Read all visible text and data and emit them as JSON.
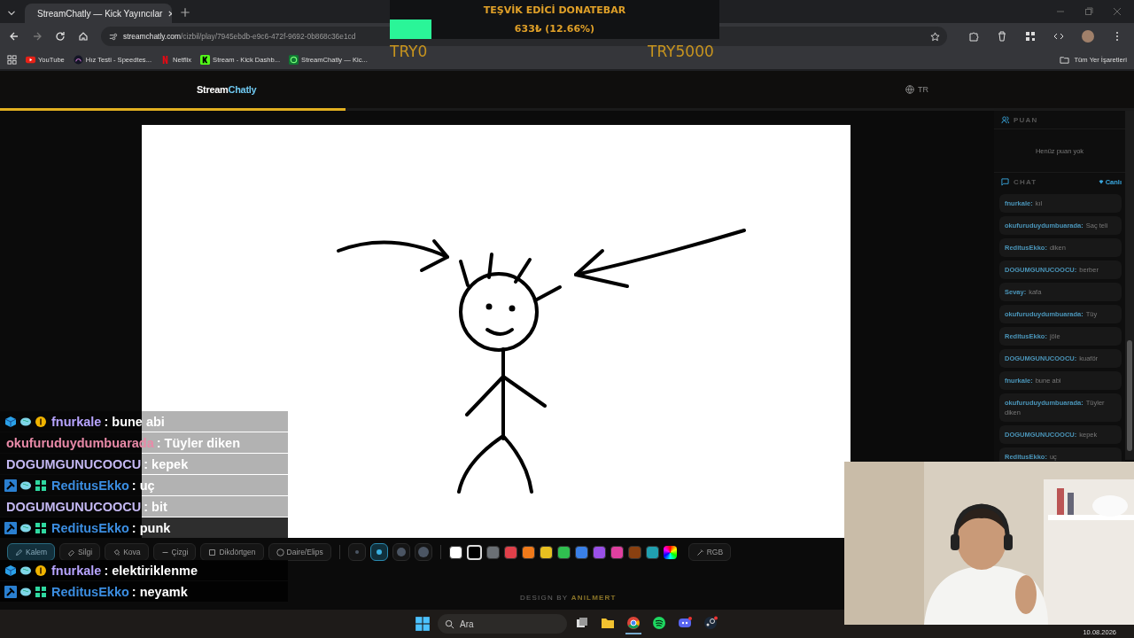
{
  "browser": {
    "tab": {
      "title": "StreamChatly — Kick Yayıncılar",
      "selected": true
    },
    "url_host": "streamchatly.com",
    "url_path": "/cizbil/play/7945ebdb-e9c6-472f-9692-0b868c36e1cd",
    "bookmarks": [
      {
        "label": "YouTube",
        "kind": "youtube"
      },
      {
        "label": "Hız Testi - Speedtes...",
        "kind": "speed"
      },
      {
        "label": "Netflix",
        "kind": "netflix"
      },
      {
        "label": "Stream - Kick Dashb...",
        "kind": "kick"
      },
      {
        "label": "StreamChatly — Kic...",
        "kind": "chatly"
      }
    ],
    "all_bookmarks": "Tüm Yer İşaretleri"
  },
  "header": {
    "logo_a": "Stream",
    "logo_b": "Chatly",
    "language": "TR",
    "progress": {
      "level": 0.305
    }
  },
  "toolbar": {
    "tools": [
      {
        "label": "Kalem",
        "selected": true
      },
      {
        "label": "Silgi",
        "selected": false
      },
      {
        "label": "Kova",
        "selected": false
      },
      {
        "label": "Çizgi",
        "selected": false
      },
      {
        "label": "Dikdörtgen",
        "selected": false
      },
      {
        "label": "Daire/Elips",
        "selected": false
      }
    ],
    "sizes": [
      {
        "selected": false
      },
      {
        "selected": true
      },
      {
        "selected": false
      },
      {
        "selected": false
      }
    ],
    "colors": [
      {
        "color": "#ffffff",
        "selected": false
      },
      {
        "color": "#000000",
        "selected": true
      },
      {
        "color": "#6b7075",
        "selected": false
      },
      {
        "color": "#e0404a",
        "selected": false
      },
      {
        "color": "#f07a1a",
        "selected": false
      },
      {
        "color": "#e8c020",
        "selected": false
      },
      {
        "color": "#30c050",
        "selected": false
      },
      {
        "color": "#3a80e8",
        "selected": false
      },
      {
        "color": "#9a50e8",
        "selected": false
      },
      {
        "color": "#e040a0",
        "selected": false
      },
      {
        "color": "#8a4010",
        "selected": false
      },
      {
        "color": "#20a0b0",
        "selected": false
      }
    ],
    "rgb": "RGB"
  },
  "credit": {
    "prefix": "DESIGN BY",
    "author": "ANILMERT"
  },
  "puan": {
    "title": "PUAN",
    "empty": "Henüz puan yok"
  },
  "chat": {
    "title": "CHAT",
    "live": "Canlı",
    "messages": [
      {
        "user": "fnurkale:",
        "text": "kıl"
      },
      {
        "user": "okufuruduydumbuarada:",
        "text": "Saç teli"
      },
      {
        "user": "ReditusEkko:",
        "text": "diken"
      },
      {
        "user": "DOGUMGUNUCOOCU:",
        "text": "berber"
      },
      {
        "user": "Sevay:",
        "text": "kafa"
      },
      {
        "user": "okufuruduydumbuarada:",
        "text": "Tüy"
      },
      {
        "user": "ReditusEkko:",
        "text": "jöle"
      },
      {
        "user": "DOGUMGUNUCOOCU:",
        "text": "kuaför"
      },
      {
        "user": "fnurkale:",
        "text": "bune abi"
      },
      {
        "user": "okufuruduydumbuarada:",
        "text": "Tüyler diken"
      },
      {
        "user": "DOGUMGUNUCOOCU:",
        "text": "kepek"
      },
      {
        "user": "ReditusEkko:",
        "text": "uç"
      }
    ]
  },
  "donate_bar": {
    "title": "TEŞVİK EDİCİ DONATEBAR",
    "amount": "633₺ (12.66%)",
    "level": 0.1266,
    "min": "TRY0",
    "max": "TRY5000"
  },
  "overlay_chat": [
    {
      "kind": "subscriber",
      "user": "fnurkale",
      "color": "#b7a4ff",
      "text": ": bune abi"
    },
    {
      "kind": "plain",
      "user": "okufuruduydumbuarada",
      "color": "#e98aa8",
      "text": ": Tüyler diken"
    },
    {
      "kind": "plain",
      "user": "DOGUMGUNUCOOCU",
      "color": "#c4b8f2",
      "text": ": kepek"
    },
    {
      "kind": "moderator",
      "user": "ReditusEkko",
      "color": "#3b8de0",
      "text": ": uç"
    },
    {
      "kind": "plain",
      "user": "DOGUMGUNUCOOCU",
      "color": "#c4b8f2",
      "text": ": bit"
    },
    {
      "kind": "moderator",
      "user": "ReditusEkko",
      "color": "#3b8de0",
      "text": ": punk"
    },
    {
      "kind": "subscriber",
      "user": "fnurkale",
      "color": "#b7a4ff",
      "text": ": elektiriklenme"
    },
    {
      "kind": "moderator",
      "user": "ReditusEkko",
      "color": "#3b8de0",
      "text": ": neyamk"
    }
  ],
  "taskbar": {
    "search_placeholder": "Ara",
    "date": "10.08.2026",
    "apps": [
      {
        "kind": "taskview"
      },
      {
        "kind": "folder"
      },
      {
        "kind": "chrome",
        "selected": true
      },
      {
        "kind": "spotify",
        "selected": false
      },
      {
        "kind": "discord",
        "selected": false
      },
      {
        "kind": "steam",
        "selected": false
      }
    ]
  }
}
